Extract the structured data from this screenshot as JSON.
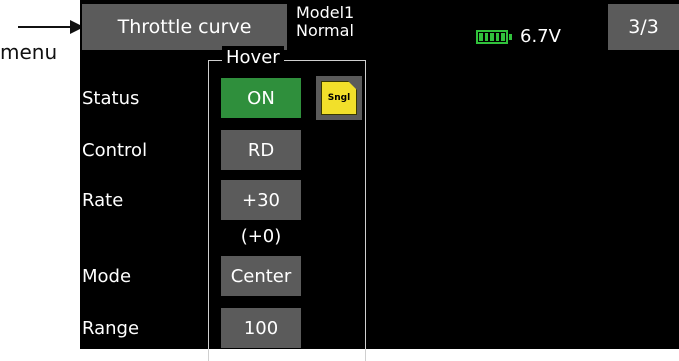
{
  "callout": {
    "text": "menu"
  },
  "header": {
    "title": "Throttle curve",
    "model_name": "Model1",
    "condition": "Normal",
    "battery_voltage": "6.7V",
    "page": "3/3"
  },
  "group": {
    "title": "Hover"
  },
  "rows": {
    "status": {
      "label": "Status",
      "value": "ON"
    },
    "control": {
      "label": "Control",
      "value": "RD"
    },
    "rate": {
      "label": "Rate",
      "value": "+30",
      "sub": "(+0)"
    },
    "mode": {
      "label": "Mode",
      "value": "Center"
    },
    "range": {
      "label": "Range",
      "value": "100"
    }
  },
  "sngl": {
    "label": "Sngl"
  },
  "colors": {
    "on_button": "#2f8f3c",
    "button": "#5b5b5b",
    "battery": "#31c23c",
    "sngl_icon": "#f2e02a"
  },
  "icons": {
    "battery": "battery-icon",
    "sngl": "sngl-icon",
    "arrow": "arrow-right-icon"
  }
}
